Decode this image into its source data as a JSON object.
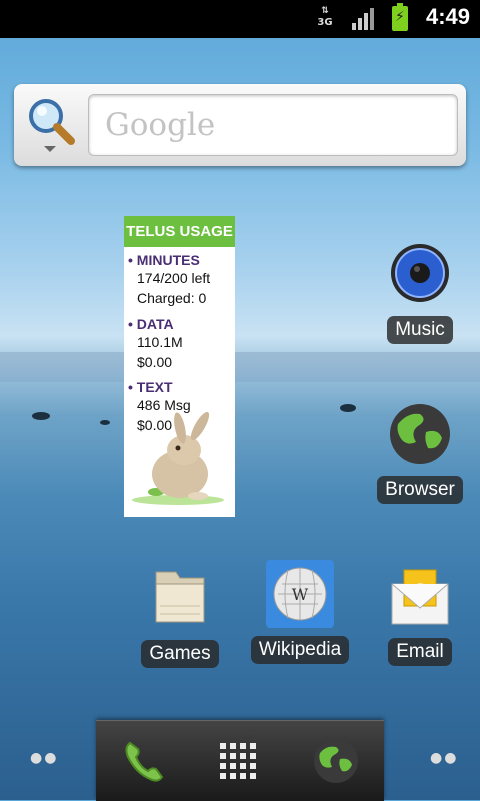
{
  "status_bar": {
    "network": "3G",
    "time": "4:49",
    "signal_icon": "signal-bars-icon",
    "battery_icon": "battery-charging-icon"
  },
  "search": {
    "placeholder": "Google",
    "icon": "magnifier-icon"
  },
  "telus_widget": {
    "title": "TELUS USAGE",
    "sections": [
      {
        "heading": "• MINUTES",
        "line1": "174/200 left",
        "line2": "Charged: 0"
      },
      {
        "heading": "• DATA",
        "line1": "110.1M",
        "line2": "$0.00"
      },
      {
        "heading": "• TEXT",
        "line1": "486 Msg",
        "line2": "$0.00"
      }
    ]
  },
  "apps": {
    "music": "Music",
    "browser": "Browser",
    "games": "Games",
    "wikipedia": "Wikipedia",
    "email": "Email"
  },
  "dock": {
    "phone": "phone-icon",
    "launcher": "app-drawer-grid-icon",
    "browser": "globe-icon"
  },
  "colors": {
    "telus_green": "#6cbf3f",
    "telus_purple": "#4a2e74"
  }
}
